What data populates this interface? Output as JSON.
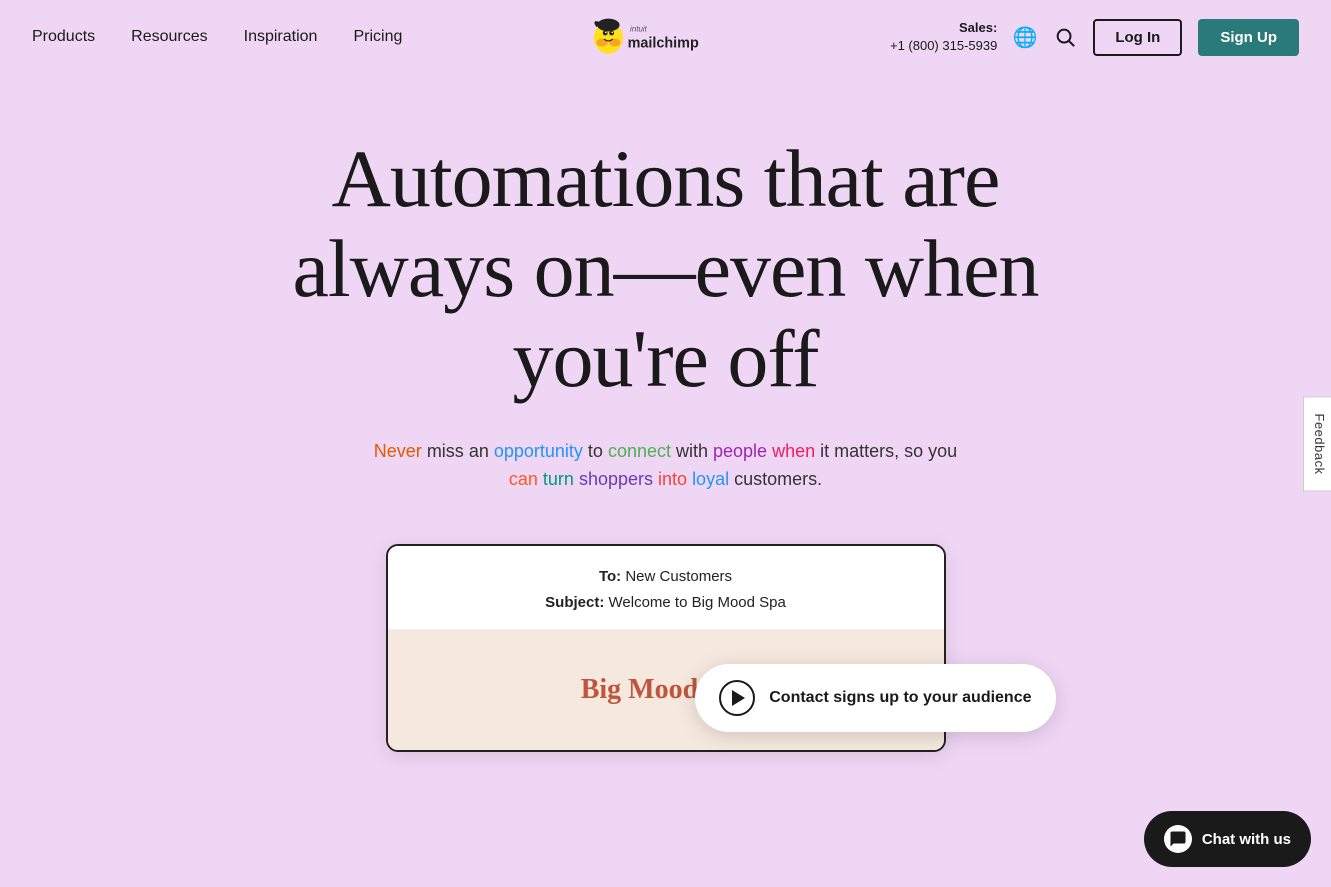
{
  "nav": {
    "items": [
      {
        "label": "Products",
        "id": "products"
      },
      {
        "label": "Resources",
        "id": "resources"
      },
      {
        "label": "Inspiration",
        "id": "inspiration"
      },
      {
        "label": "Pricing",
        "id": "pricing"
      }
    ],
    "logo_alt": "Intuit Mailchimp",
    "sales_label": "Sales:",
    "sales_phone": "+1 (800) 315-5939",
    "login_label": "Log In",
    "signup_label": "Sign Up"
  },
  "hero": {
    "headline": "Automations that are always on—even when you're off",
    "subtext_plain": "Never miss an opportunity to connect with people when it matters, so you can turn shoppers into loyal customers.",
    "subtext_raw": "Never miss an opportunity to connect with people when it matters, so you can turn shoppers into loyal customers."
  },
  "email_preview": {
    "to_label": "To:",
    "to_value": "New Customers",
    "subject_label": "Subject:",
    "subject_value": "Welcome to Big Mood Spa",
    "brand_name": "Big Mood Spa"
  },
  "trigger_badge": {
    "label": "Contact signs up to your audience"
  },
  "feedback": {
    "label": "Feedback"
  },
  "chat": {
    "label": "Chat with us"
  },
  "colors": {
    "background": "#f0d6f5",
    "nav_bg": "#f0d6f5",
    "signup_bg": "#2a7a7a",
    "email_body_bg": "#f5e8de",
    "brand_color": "#c0553e",
    "bottom_bg": "#f5f0f0",
    "chat_bg": "#1a1a1a"
  }
}
